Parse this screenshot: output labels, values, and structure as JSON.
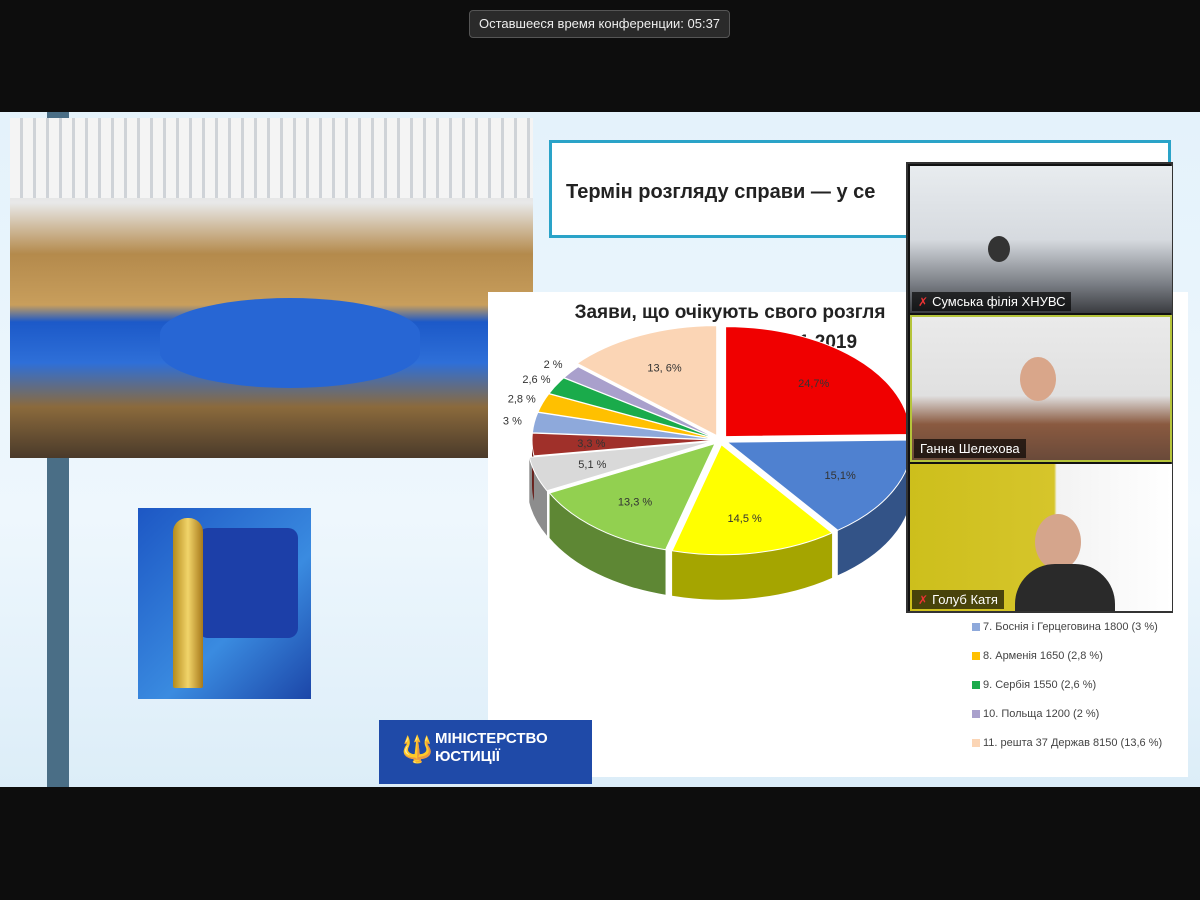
{
  "conference": {
    "timer_text": "Оставшееся время конференции: 05:37"
  },
  "slide": {
    "title": "Термін розгляду справи — у се",
    "chart_title_line1": "Заяви, що очікують свого розгля",
    "chart_title_line2": "30.11.2019",
    "ministry_line1": "МІНІСТЕРСТВО",
    "ministry_line2": "ЮСТИЦІЇ",
    "ministry_icon": "trident-icon"
  },
  "chart_data": {
    "type": "pie",
    "values": [
      24.7,
      15.1,
      14.5,
      13.3,
      5.1,
      3.3,
      3,
      2.8,
      2.6,
      2,
      13.6
    ],
    "labels": [
      "24,7%",
      "15,1%",
      "14,5 %",
      "13,3 %",
      "5,1 %",
      "3,3 %",
      "3 %",
      "2,8 %",
      "2,6 %",
      "2 %",
      "13, 6%"
    ],
    "colors": [
      "#f00000",
      "#4f81d0",
      "#ffff00",
      "#92d050",
      "#d9d9d9",
      "#a0302a",
      "#8ea9db",
      "#ffc000",
      "#1aab4b",
      "#a9a0cc",
      "#fbd5b5"
    ],
    "legend_visible": [
      {
        "text": "7. Боснія і Герцеговина 1800 (3 %)",
        "color": "#8ea9db"
      },
      {
        "text": "8. Арменія 1650 (2,8 %)",
        "color": "#ffc000"
      },
      {
        "text": "9. Сербія 1550 (2,6 %)",
        "color": "#1aab4b"
      },
      {
        "text": "10. Польща 1200 (2 %)",
        "color": "#a9a0cc"
      },
      {
        "text": "11. решта 37 Держав 8150 (13,6 %)",
        "color": "#fbd5b5"
      }
    ]
  },
  "participants": [
    {
      "name": "Сумська філія ХНУВС",
      "muted": true
    },
    {
      "name": "Ганна Шелехова",
      "muted": false
    },
    {
      "name": "Голуб Катя",
      "muted": true
    }
  ]
}
